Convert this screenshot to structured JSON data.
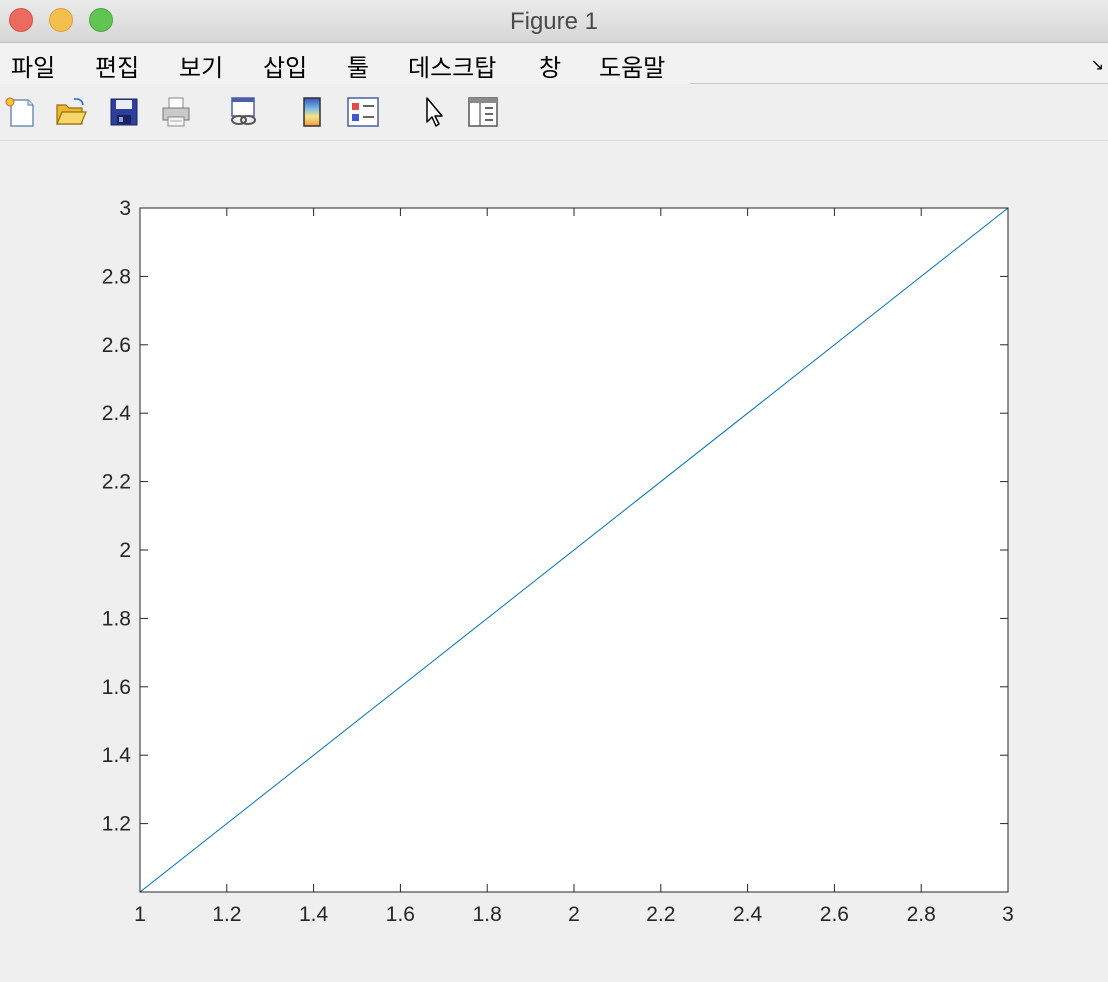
{
  "window": {
    "title": "Figure 1"
  },
  "menu": [
    "파일",
    "편집",
    "보기",
    "삽입",
    "툴",
    "데스크탑",
    "창",
    "도움말"
  ],
  "toolbar": {
    "icons": [
      "new-figure-icon",
      "open-file-icon",
      "save-icon",
      "print-icon",
      "link-plot-icon",
      "colorbar-icon",
      "legend-icon",
      "pointer-icon",
      "property-inspector-icon"
    ]
  },
  "chart_data": {
    "type": "line",
    "title": "",
    "xlabel": "",
    "ylabel": "",
    "xlim": [
      1,
      3
    ],
    "ylim": [
      1,
      3
    ],
    "grid": false,
    "x_ticks": [
      "1",
      "1.2",
      "1.4",
      "1.6",
      "1.8",
      "2",
      "2.2",
      "2.4",
      "2.6",
      "2.8",
      "3"
    ],
    "y_ticks": [
      "1.2",
      "1.4",
      "1.6",
      "1.8",
      "2",
      "2.2",
      "2.4",
      "2.6",
      "2.8",
      "3"
    ],
    "series": [
      {
        "x": [
          1,
          3
        ],
        "y": [
          1,
          3
        ],
        "color": "#0072bd"
      }
    ]
  }
}
